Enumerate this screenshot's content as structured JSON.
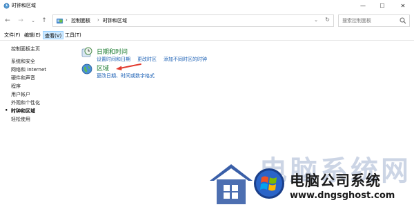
{
  "window": {
    "title": "时钟和区域",
    "controls": {
      "minimize": "—",
      "maximize": "☐",
      "close": "✕"
    }
  },
  "navigation": {
    "back": "←",
    "forward": "→",
    "recent": "⌄",
    "up": "↑"
  },
  "address": {
    "separator": "›",
    "breadcrumbs": [
      "控制面板",
      "时钟和区域"
    ],
    "dropdown": "⌄",
    "refresh": "↻"
  },
  "search": {
    "placeholder": "搜索控制面板"
  },
  "menu": {
    "items": [
      {
        "label": "文件(F)",
        "active": false
      },
      {
        "label": "编辑(E)",
        "active": false
      },
      {
        "label": "查看(V)",
        "active": true
      },
      {
        "label": "工具(T)",
        "active": false
      }
    ]
  },
  "sidebar": {
    "items": [
      "控制面板主页",
      "系统和安全",
      "网络和 Internet",
      "硬件和声音",
      "程序",
      "用户帐户",
      "外观和个性化",
      "时钟和区域",
      "轻松使用"
    ],
    "current_index": 7,
    "bullet": "•"
  },
  "categories": [
    {
      "title": "日期和时间",
      "icon": "clock-globe-icon",
      "links": [
        "设置时间和日期",
        "更改时区",
        "添加不同时区的时钟"
      ]
    },
    {
      "title": "区域",
      "icon": "globe-icon",
      "links": [
        "更改日期、时间或数字格式"
      ]
    }
  ],
  "watermark": {
    "big_text": "电脑系统网",
    "name": "电脑公司系统",
    "url": "www.dngsghost.com"
  },
  "colors": {
    "link": "#1a5fb4",
    "category_title": "#1e7d32",
    "arrow": "#e23a2e",
    "menu_active": "#cce8ff"
  }
}
